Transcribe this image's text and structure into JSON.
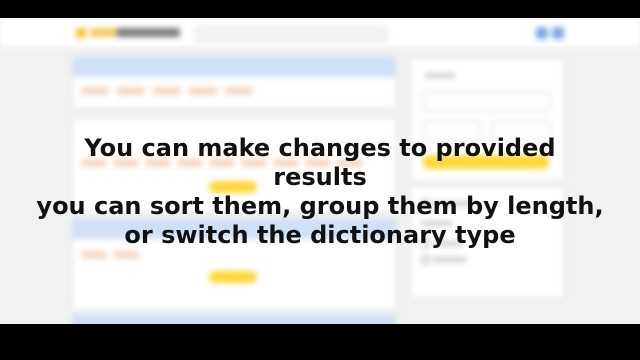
{
  "overlay": {
    "lines": [
      "You can make changes to provided",
      "results",
      "you can sort them, group them by length,",
      "or switch the dictionary type"
    ]
  },
  "colors": {
    "letterbox": "#000000",
    "page_background": "#f1f1f1",
    "card_header": "#cfe0f5",
    "accent_button": "#ffd83a",
    "word_chip": "#f3d9c4",
    "overlay_text": "#111111"
  },
  "icons": {
    "logo": "logo-icon",
    "header_buttons": [
      "menu-icon",
      "user-icon"
    ]
  }
}
